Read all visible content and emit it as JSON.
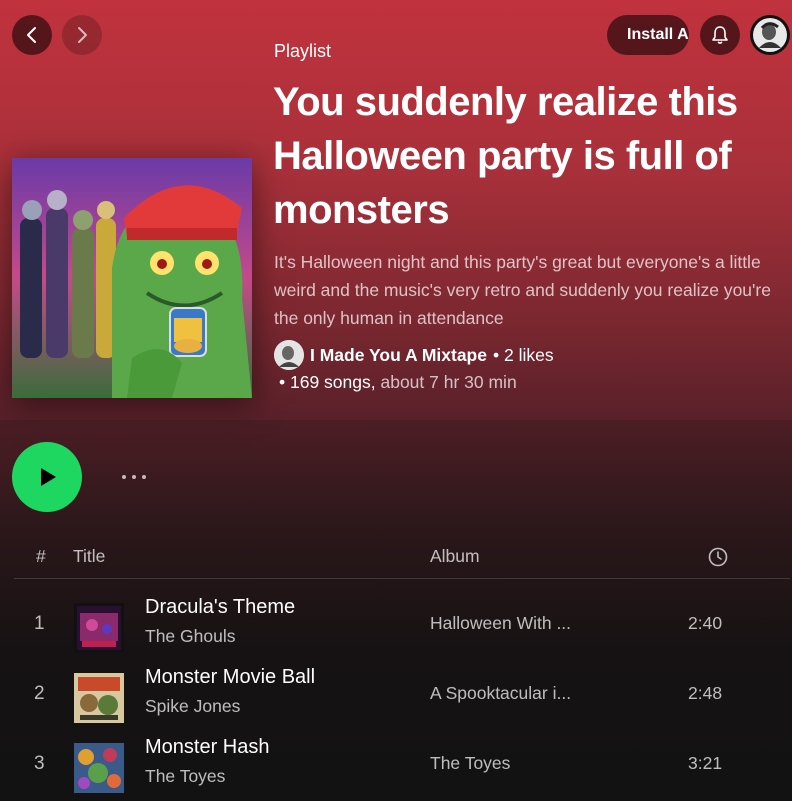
{
  "header": {
    "install_label": "Install App"
  },
  "playlist": {
    "kind": "Playlist",
    "title": "You suddenly realize this Halloween party is full of monsters",
    "description": "It's Halloween night and this party's great but everyone's a little weird and the music's very retro and suddenly you realize you're the only human in attendance",
    "owner": "I Made You A Mixtape",
    "likes": "• 2 likes",
    "songs": "• 169 songs,",
    "duration": "about 7 hr 30 min"
  },
  "table": {
    "headers": {
      "number": "#",
      "title": "Title",
      "album": "Album"
    },
    "rows": [
      {
        "number": "1",
        "title": "Dracula's Theme",
        "artist": "The Ghouls",
        "album": "Halloween With ...",
        "duration": "2:40"
      },
      {
        "number": "2",
        "title": "Monster Movie Ball",
        "artist": "Spike Jones",
        "album": "A Spooktacular i...",
        "duration": "2:48"
      },
      {
        "number": "3",
        "title": "Monster Hash",
        "artist": "The Toyes",
        "album": "The Toyes",
        "duration": "3:21"
      }
    ]
  },
  "colors": {
    "accent": "#1ed760",
    "hero": "#c1323d"
  },
  "icons": [
    "chevron-left-icon",
    "chevron-right-icon",
    "download-icon",
    "bell-icon",
    "play-icon",
    "clock-icon",
    "more-icon"
  ]
}
